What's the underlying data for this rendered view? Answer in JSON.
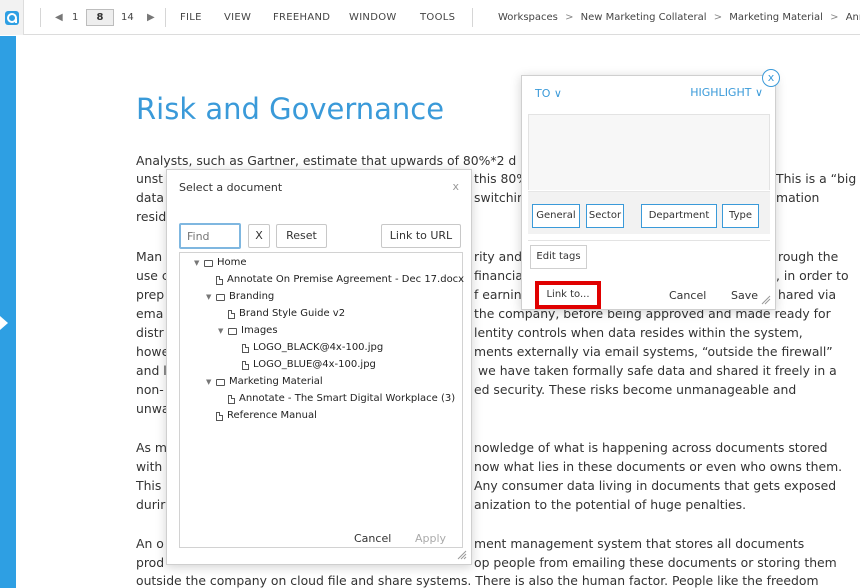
{
  "toolbar": {
    "page_prev": "1",
    "page_current": "8",
    "page_total": "14",
    "menu": [
      "FILE",
      "VIEW",
      "FREEHAND",
      "WINDOW",
      "TOOLS"
    ],
    "breadcrumb": [
      "Workspaces",
      "New Marketing Collateral",
      "Marketing Material",
      "Annotate"
    ],
    "breadcrumb_sep": ">",
    "accent_color": "#2e9fe3"
  },
  "document": {
    "title": "Risk and Governance",
    "lines": [
      "Analysts, such as Gartner, estimate that upwards of 80%*2 d",
      "unst",
      "data",
      "resid",
      "Man",
      "use c",
      "prep",
      "ema",
      "distr",
      "howe",
      "and l",
      "non-",
      "unwa",
      "As m",
      "with",
      "This",
      "durir",
      "An o",
      "prod",
      "outside the company on cloud file and share systems. There is also the human factor. People like the freedom"
    ],
    "right_fragments": [
      "this 80%",
      "This is a “big",
      "switchin",
      "mation",
      "rity and",
      "rough the",
      "financia",
      ", in order to",
      "f earnin",
      "hared via",
      "the company, before being approved and made ready for",
      "lentity controls when data resides within the system,",
      "ments externally via email systems, “outside the firewall”",
      "we have taken formally safe data and shared it freely in a",
      "ed security.  These risks become unmanageable and",
      "nowledge of what is happening across documents stored",
      "now what lies in these documents or even who owns them.",
      "Any consumer data living in documents that gets exposed",
      "anization to the potential of huge penalties.",
      "ment management system that stores all documents",
      "op people from emailing these documents or storing them"
    ]
  },
  "dialog": {
    "title": "Select a document",
    "close": "x",
    "find_placeholder": "Find",
    "clear_label": "X",
    "reset_label": "Reset",
    "link_url_label": "Link to URL",
    "tree": [
      {
        "label": "Home",
        "type": "folder",
        "expanded": true
      },
      {
        "label": "Annotate On Premise Agreement - Dec 17.docx",
        "type": "file"
      },
      {
        "label": "Branding",
        "type": "folder",
        "expanded": true
      },
      {
        "label": "Brand Style Guide v2",
        "type": "file"
      },
      {
        "label": "Images",
        "type": "folder",
        "expanded": true
      },
      {
        "label": "LOGO_BLACK@4x-100.jpg",
        "type": "file"
      },
      {
        "label": "LOGO_BLUE@4x-100.jpg",
        "type": "file"
      },
      {
        "label": "Marketing Material",
        "type": "folder",
        "expanded": true
      },
      {
        "label": "Annotate - The Smart Digital Workplace (3)",
        "type": "file"
      },
      {
        "label": "Reference Manual",
        "type": "file"
      }
    ],
    "cancel_label": "Cancel",
    "apply_label": "Apply"
  },
  "popup": {
    "to_label": "TO ∨",
    "highlight_label": "HIGHLIGHT ∨",
    "close_label": "x",
    "tags": [
      "General",
      "Sector",
      "Department",
      "Type"
    ],
    "edit_tags_label": "Edit tags",
    "link_to_label": "Link to...",
    "cancel_label": "Cancel",
    "save_label": "Save",
    "highlight_color": "#e00000"
  }
}
